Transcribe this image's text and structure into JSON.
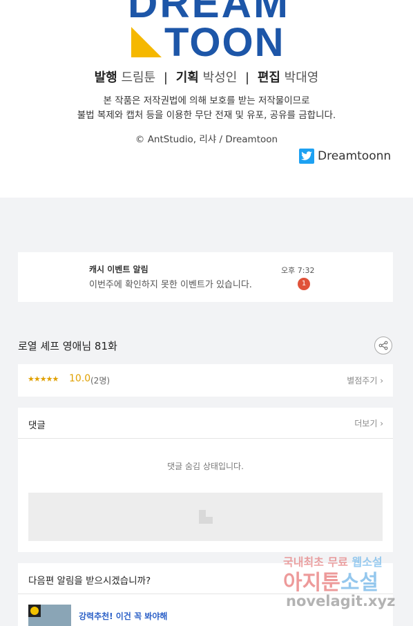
{
  "logo": {
    "top_text": "DREAM",
    "word": "TOON"
  },
  "credits": {
    "publisher_label": "발행",
    "publisher": "드림툰",
    "planning_label": "기획",
    "planner": "박성인",
    "editing_label": "편집",
    "editor": "박대영",
    "separator": "|"
  },
  "notice": {
    "line1": "본 작품은 저작권법에 의해 보호를 받는 저작물이므로",
    "line2": "불법 복제와 캡처 등을 이용한 무단 전재 및 유포, 공유를 금합니다."
  },
  "copyright": "© AntStudio, 리샤 / Dreamtoon",
  "twitter": {
    "label": "Dreamtoonn",
    "icon": "twitter-bird-icon",
    "color": "#1da1f2"
  },
  "notification": {
    "title": "캐시 이벤트 알림",
    "message": "이번주에 확인하지 못한 이벤트가 있습니다.",
    "time": "오후 7:32",
    "badge": "1"
  },
  "episode": {
    "title": "로열 셰프 영애님 81화",
    "share_icon": "share-icon"
  },
  "rating": {
    "stars": "★★★★★",
    "score": "10.0",
    "count": "(2명)",
    "action": "별점주기 ›"
  },
  "comments": {
    "title": "댓글",
    "more": "더보기 ›",
    "hidden_message": "댓글 숨김 상태입니다."
  },
  "next_episode": {
    "question": "다음편 알림을 받으시겠습니까?",
    "promo": "강력추천! 이건 꼭 봐야해"
  },
  "watermark": {
    "line1_a": "국내최초 무료 ",
    "line1_b": "웹소설",
    "line2_a": "아지툰",
    "line2_b": "소설",
    "line3": "novelagit.xyz"
  },
  "colors": {
    "brand_blue": "#1d56a8",
    "brand_yellow": "#f5b800",
    "star": "#e0a000",
    "badge": "#e0533a"
  }
}
